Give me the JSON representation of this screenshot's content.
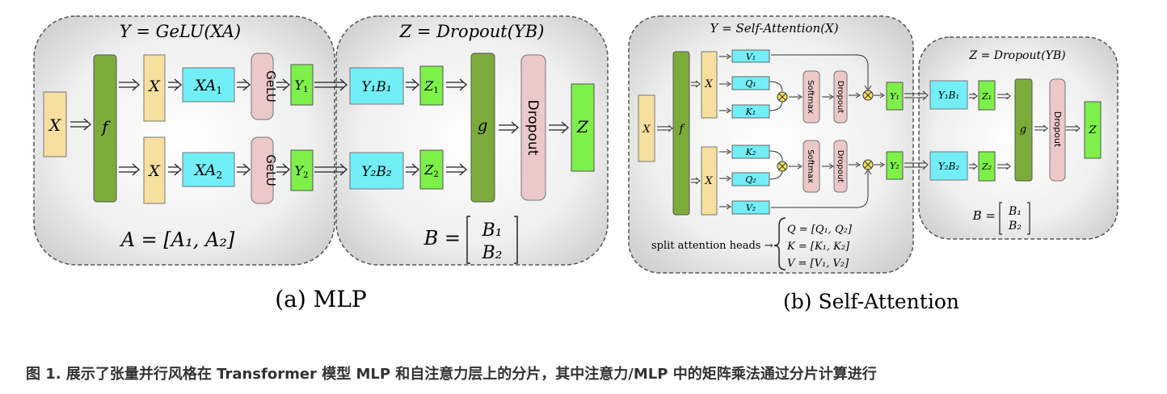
{
  "mlp": {
    "panel_y_title": "Y = GeLU(XA)",
    "panel_z_title": "Z = Dropout(YB)",
    "x_in": "X",
    "f": "f",
    "x1": "X",
    "x2": "X",
    "xa1": "XA",
    "xa1_sub": "1",
    "xa2": "XA",
    "xa2_sub": "2",
    "gelu1": "GeLU",
    "gelu2": "GeLU",
    "y1": "Y",
    "y1_sub": "1",
    "y2": "Y",
    "y2_sub": "2",
    "y1b1": "Y₁B₁",
    "y2b2": "Y₂B₂",
    "z1": "Z",
    "z1_sub": "1",
    "z2": "Z",
    "z2_sub": "2",
    "g": "g",
    "dropout": "Dropout",
    "z": "Z",
    "a_formula": "A = [A₁, A₂]",
    "b_prefix": "B =",
    "b1": "B₁",
    "b2": "B₂",
    "caption": "(a) MLP"
  },
  "attn": {
    "panel_y_title": "Y = Self-Attention(X)",
    "panel_z_title": "Z = Dropout(YB)",
    "x_in": "X",
    "f": "f",
    "x1": "X",
    "x2": "X",
    "v1": "V₁",
    "q1": "Q₁",
    "k1": "K₁",
    "k2": "K₂",
    "q2": "Q₂",
    "v2": "V₂",
    "softmax": "Softmax",
    "dropout": "Dropout",
    "y1": "Y₁",
    "y2": "Y₂",
    "y1b1": "Y₁B₁",
    "y2b2": "Y₂B₂",
    "z1": "Z₁",
    "z2": "Z₂",
    "g": "g",
    "dropout2": "Dropout",
    "z": "Z",
    "split_label": "split attention heads →",
    "q_split": "Q = [Q₁, Q₂]",
    "k_split": "K = [K₁, K₂]",
    "v_split": "V = [V₁, V₂]",
    "b_prefix": "B =",
    "b1": "B₁",
    "b2": "B₂",
    "caption": "(b) Self-Attention"
  },
  "figure_caption": "图 1. 展示了张量并行风格在 Transformer 模型 MLP 和自注意力层上的分片，其中注意力/MLP 中的矩阵乘法通过分片计算进行",
  "colors": {
    "yellow": "#f7dfa0",
    "green_dark": "#7cab3c",
    "cyan": "#73eef6",
    "pink": "#ecc8c8",
    "green_light": "#7df04a"
  }
}
